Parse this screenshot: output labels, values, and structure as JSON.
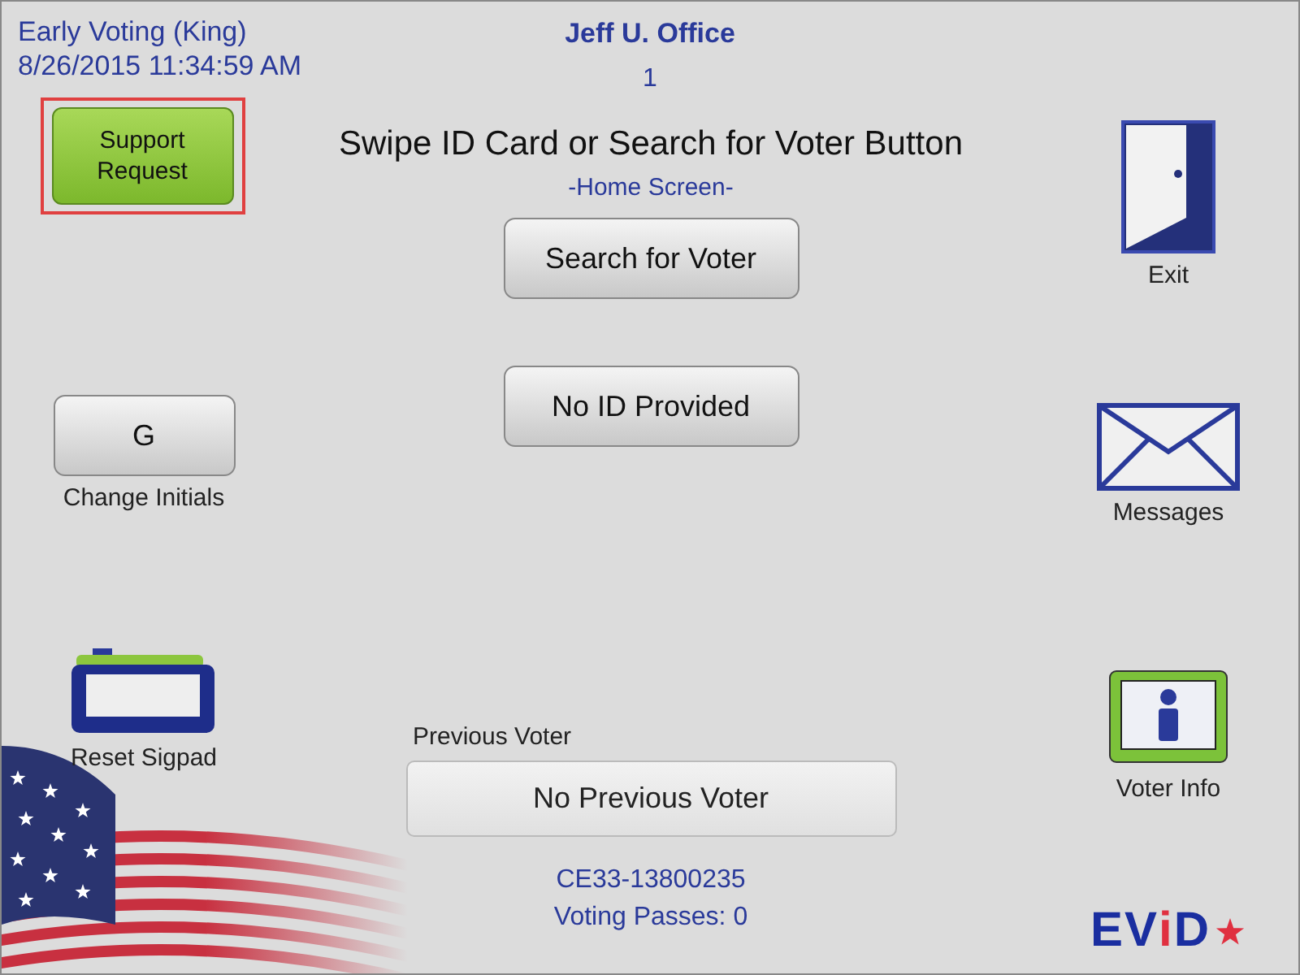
{
  "header": {
    "mode": "Early Voting (King)",
    "datetime": "8/26/2015 11:34:59 AM",
    "office": "Jeff U. Office",
    "station": "1"
  },
  "support_button": {
    "label_lines": [
      "Support",
      "Request"
    ],
    "highlighted": true
  },
  "prompt": {
    "title": "Swipe ID Card or Search for Voter Button",
    "subtitle": "-Home Screen-"
  },
  "center_buttons": [
    {
      "label": "Search for Voter"
    },
    {
      "label": "No ID Provided"
    }
  ],
  "initials": {
    "value": "G",
    "label": "Change Initials"
  },
  "left_actions": [
    {
      "kind": "sigpad",
      "label": "Reset Sigpad"
    }
  ],
  "right_actions": [
    {
      "kind": "exit",
      "label": "Exit"
    },
    {
      "kind": "messages",
      "label": "Messages"
    },
    {
      "kind": "info",
      "label": "Voter Info"
    }
  ],
  "previous_voter": {
    "label": "Previous Voter",
    "value": "No Previous Voter"
  },
  "footer": {
    "device_id": "CE33-13800235",
    "passes": "Voting Passes: 0"
  },
  "logo": {
    "parts": [
      {
        "text": "EV",
        "accent": false
      },
      {
        "text": "i",
        "accent": true
      },
      {
        "text": "D",
        "accent": false
      }
    ]
  }
}
